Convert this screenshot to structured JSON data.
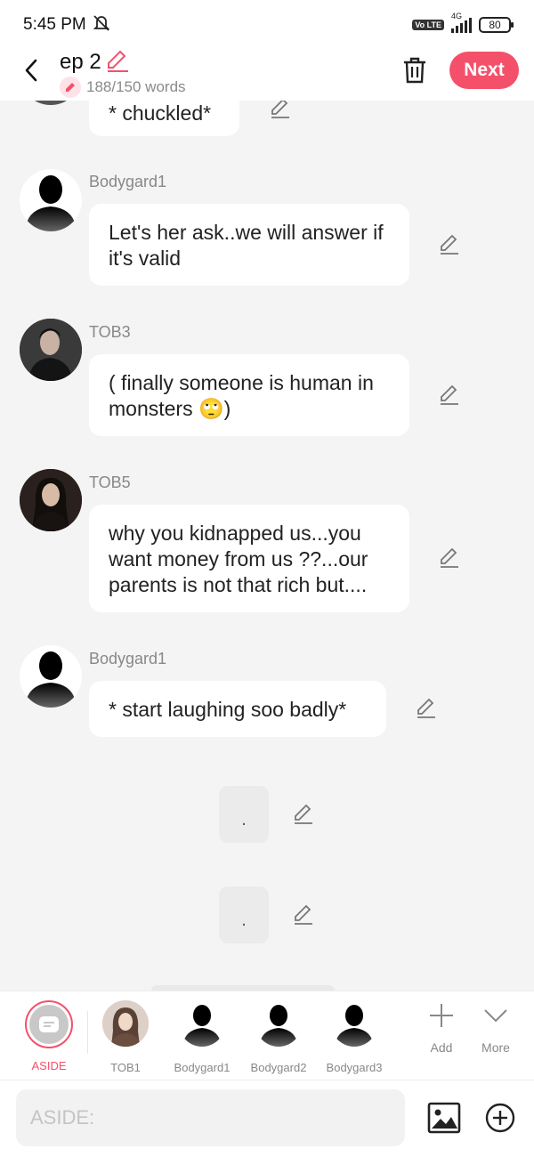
{
  "status_bar": {
    "time": "5:45 PM",
    "network": "4G",
    "volte": "Vo LTE",
    "battery": "80"
  },
  "header": {
    "title": "ep 2",
    "word_count": "188/150 words",
    "next_label": "Next"
  },
  "messages": [
    {
      "speaker": "",
      "text": "* chuckled*",
      "partial": true
    },
    {
      "speaker": "Bodygard1",
      "text": "Let's her ask..we will answer if it's valid",
      "avatar": "silhouette"
    },
    {
      "speaker": "TOB3",
      "text": "( finally someone is human in monsters 🙄)",
      "avatar": "photo-male"
    },
    {
      "speaker": "TOB5",
      "text": "why you kidnapped us...you want money from us ??...our parents is not that rich but....",
      "avatar": "photo-female"
    },
    {
      "speaker": "Bodygard1",
      "text": "* start laughing soo badly*",
      "avatar": "silhouette"
    }
  ],
  "narration": [
    ".",
    "."
  ],
  "characters": [
    {
      "label": "ASIDE",
      "active": true
    },
    {
      "label": "TOB1"
    },
    {
      "label": "Bodygard1"
    },
    {
      "label": "Bodygard2"
    },
    {
      "label": "Bodygard3"
    }
  ],
  "tools": {
    "add_label": "Add",
    "more_label": "More"
  },
  "input": {
    "placeholder": "ASIDE:"
  },
  "colors": {
    "accent": "#f5506a",
    "background": "#f4f4f4",
    "bubble": "#ffffff"
  }
}
